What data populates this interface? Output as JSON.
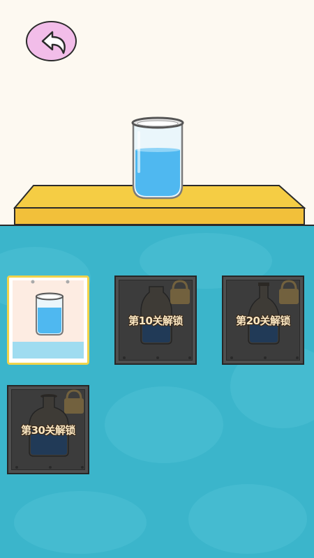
{
  "back_button": {
    "icon": "back-arrow-icon"
  },
  "display": {
    "item": "glass-cup-with-water",
    "water_color": "#4fb8f0"
  },
  "colors": {
    "background_top": "#fdf9f1",
    "shelf": "#f5cd44",
    "background_bottom": "#3bb5cb",
    "back_button": "#f2bde9",
    "selected_border": "#f0d34a"
  },
  "items": [
    {
      "type": "glass-cup",
      "state": "selected",
      "label": ""
    },
    {
      "type": "milk-bottle",
      "state": "locked",
      "label": "第10关解锁"
    },
    {
      "type": "flask-bottle",
      "state": "locked",
      "label": "第20关解锁"
    },
    {
      "type": "wine-bottle",
      "state": "locked",
      "label": "第30关解锁"
    }
  ]
}
